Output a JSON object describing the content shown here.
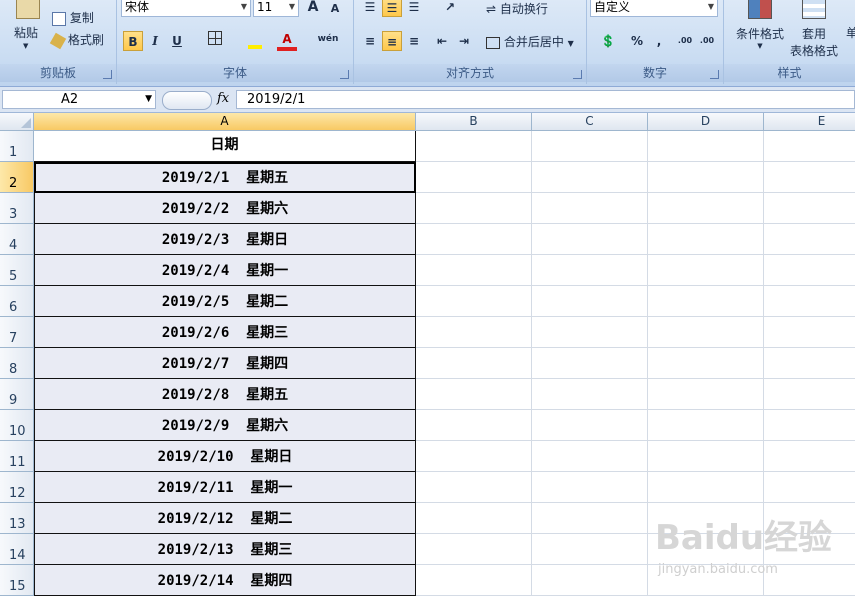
{
  "ribbon": {
    "clipboard": {
      "label": "剪贴板",
      "paste": "粘贴",
      "copy": "复制",
      "format_painter": "格式刷"
    },
    "font": {
      "label": "字体",
      "font_name": "宋体",
      "font_size": "11",
      "grow": "A",
      "shrink": "A",
      "bold": "B",
      "italic": "I",
      "underline": "U",
      "phonetic": "wén"
    },
    "alignment": {
      "label": "对齐方式",
      "wrap_text": "自动换行",
      "merge_center": "合并后居中"
    },
    "number": {
      "label": "数字",
      "format": "自定义",
      "percent": "%",
      "comma": ",",
      "inc_decimal": ".00",
      "dec_decimal": ".00"
    },
    "styles": {
      "label": "样式",
      "conditional": "条件格式",
      "table_format_1": "套用",
      "table_format_2": "表格格式",
      "cell_style": "单"
    }
  },
  "formula_bar": {
    "name_box": "A2",
    "fx": "fx",
    "content": "2019/2/1"
  },
  "columns": [
    "A",
    "B",
    "C",
    "D",
    "E"
  ],
  "rows": [
    "1",
    "2",
    "3",
    "4",
    "5",
    "6",
    "7",
    "8",
    "9",
    "10",
    "11",
    "12",
    "13",
    "14",
    "15"
  ],
  "header_cell": "日期",
  "dates": [
    "2019/2/1  星期五",
    "2019/2/2  星期六",
    "2019/2/3  星期日",
    "2019/2/4  星期一",
    "2019/2/5  星期二",
    "2019/2/6  星期三",
    "2019/2/7  星期四",
    "2019/2/8  星期五",
    "2019/2/9  星期六",
    "2019/2/10  星期日",
    "2019/2/11  星期一",
    "2019/2/12  星期二",
    "2019/2/13  星期三",
    "2019/2/14  星期四"
  ],
  "watermark": {
    "brand": "Baidu经验",
    "url": "jingyan.baidu.com"
  },
  "colors": {
    "ribbon_bg": "#c9dcf2",
    "selected_header": "#f8c964",
    "data_fill": "#e9ebf4",
    "font_color_red": "#e02020",
    "highlight_yellow": "#ffee00"
  }
}
